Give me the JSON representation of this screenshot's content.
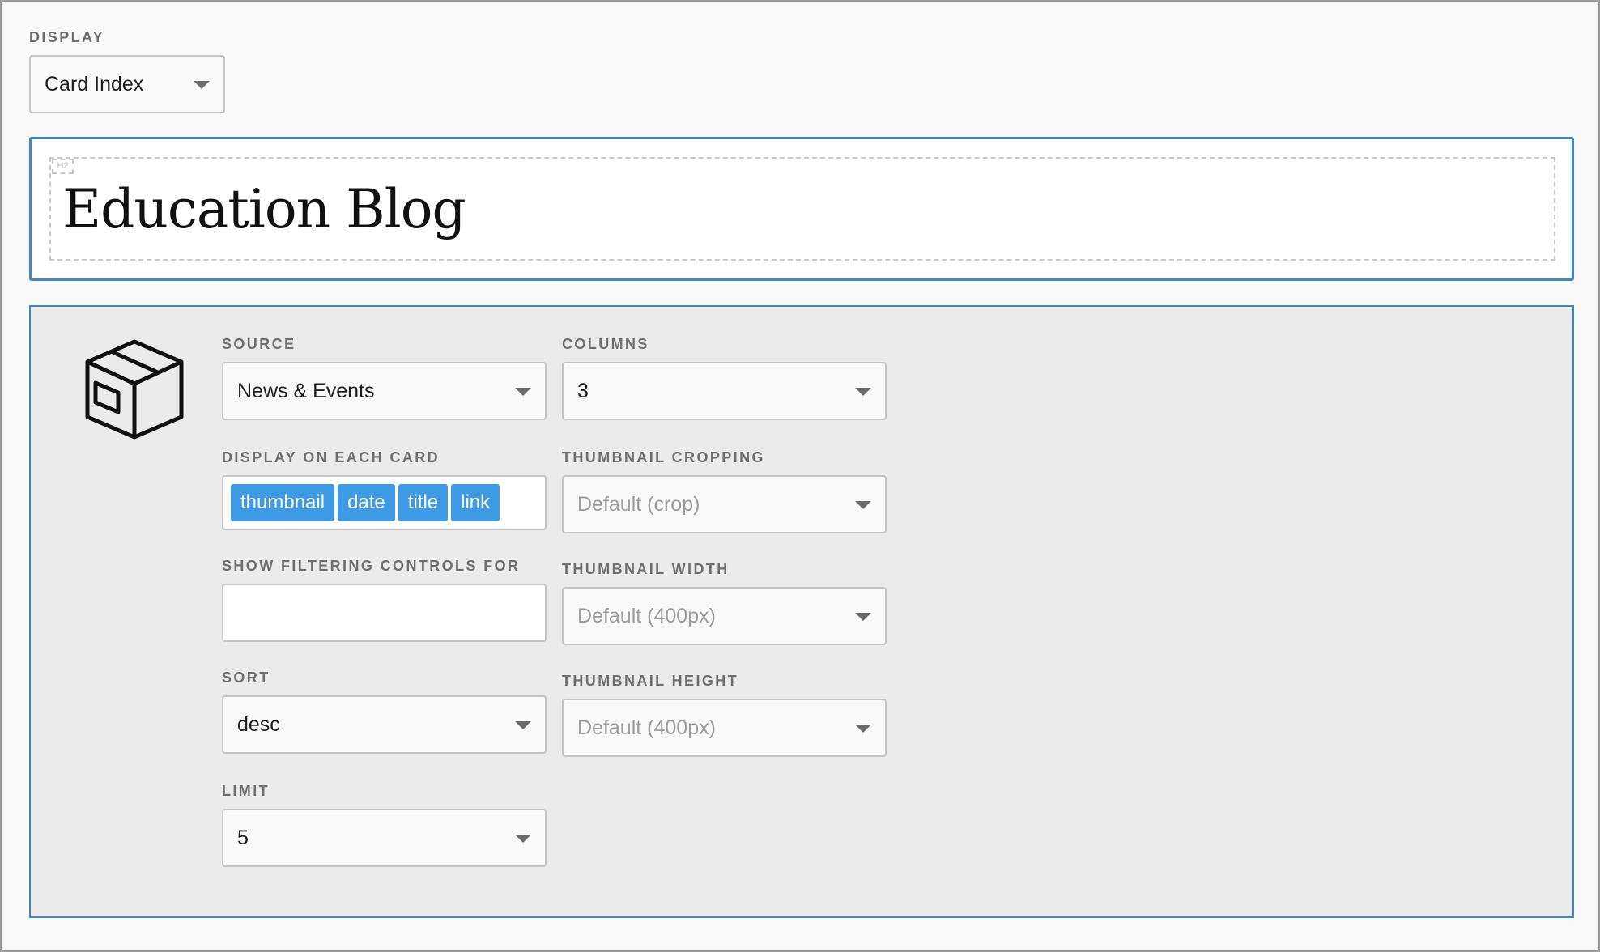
{
  "display": {
    "label": "DISPLAY",
    "value": "Card Index"
  },
  "title_block": {
    "heading_tag": "H2",
    "title": "Education Blog"
  },
  "settings": {
    "icon": "box-icon",
    "source": {
      "label": "SOURCE",
      "value": "News & Events"
    },
    "columns": {
      "label": "COLUMNS",
      "value": "3"
    },
    "display_on_card": {
      "label": "DISPLAY ON EACH CARD",
      "tags": [
        "thumbnail",
        "date",
        "title",
        "link"
      ]
    },
    "thumbnail_cropping": {
      "label": "THUMBNAIL CROPPING",
      "placeholder": "Default (crop)"
    },
    "filtering": {
      "label": "SHOW FILTERING CONTROLS FOR",
      "value": ""
    },
    "thumbnail_width": {
      "label": "THUMBNAIL WIDTH",
      "placeholder": "Default (400px)"
    },
    "sort": {
      "label": "SORT",
      "value": "desc"
    },
    "thumbnail_height": {
      "label": "THUMBNAIL HEIGHT",
      "placeholder": "Default (400px)"
    },
    "limit": {
      "label": "LIMIT",
      "value": "5"
    }
  },
  "colors": {
    "accent_border": "#3d85d0",
    "tag_background": "#3d9be5",
    "panel_background": "#ebebeb"
  }
}
